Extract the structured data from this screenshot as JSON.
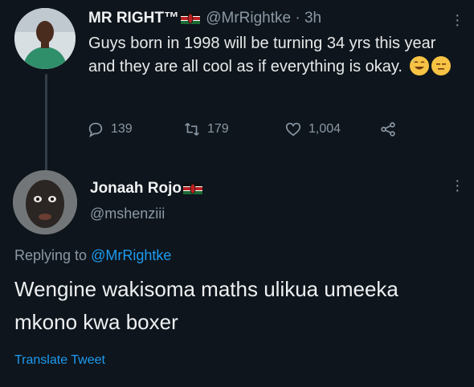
{
  "tweet1": {
    "name": "MR RIGHT™",
    "handle": "@MrRightke",
    "time": "· 3h",
    "text": "Guys born in 1998 will be turning 34 yrs this year and they are all cool as if everything is okay.",
    "emojis": [
      "grinning-sweat-emoji",
      "expressionless-face-emoji"
    ],
    "replies": "139",
    "retweets": "179",
    "likes": "1,004"
  },
  "tweet2": {
    "name": "Jonaah Rojo",
    "handle": "@mshenziii",
    "replying_prefix": "Replying to ",
    "replying_to": "@MrRightke",
    "text": "Wengine wakisoma maths ulikua umeeka mkono kwa boxer",
    "translate": "Translate Tweet"
  },
  "colors": {
    "background": "#0e151c",
    "link": "#1d9bf0",
    "muted": "#8b98a5",
    "text": "#e7e9ea"
  }
}
